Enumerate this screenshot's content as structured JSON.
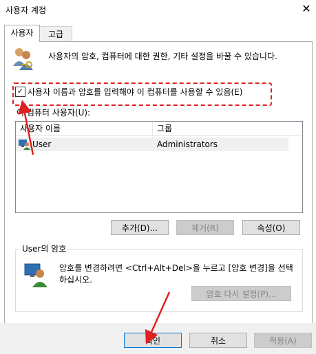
{
  "window": {
    "title": "사용자 계정",
    "close_glyph": "✕"
  },
  "tabs": [
    {
      "label": "사용자",
      "active": true
    },
    {
      "label": "고급",
      "active": false
    }
  ],
  "main": {
    "description": "사용자의 암호, 컴퓨터에 대한 권한, 기타 설정을 바꿀 수 있습니다.",
    "require_login": {
      "label": "사용자 이름과 암호를 입력해야 이 컴퓨터를 사용할 수 있음(E)",
      "checked": true,
      "check_glyph": "✓"
    },
    "users_label": "이 컴퓨터 사용자(U):",
    "users_table": {
      "columns": [
        "사용자 이름",
        "그룹"
      ],
      "rows": [
        {
          "name": "User",
          "group": "Administrators"
        }
      ]
    },
    "buttons": {
      "add": "추가(D)...",
      "remove": "제거(R)",
      "properties": "속성(O)"
    }
  },
  "password_group": {
    "title": "User의 암호",
    "text": "암호를 변경하려면 <Ctrl+Alt+Del>을 누르고 [암호 변경]을 선택하십시오.",
    "reset_button": "암호 다시 설정(P)..."
  },
  "footer": {
    "ok": "확인",
    "cancel": "취소",
    "apply": "적용(A)"
  },
  "colors": {
    "annotation": "#e02020",
    "accent": "#0078d7"
  },
  "icons": {
    "header": "users-keys-icon",
    "user_row": "user-icon",
    "password": "user-key-icon"
  }
}
